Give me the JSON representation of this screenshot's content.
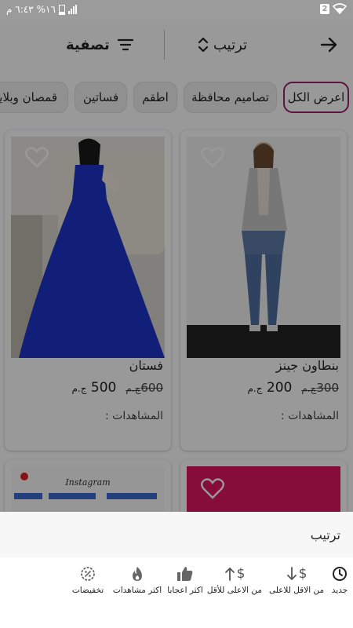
{
  "status_bar": {
    "time": "٦:٤٣ م",
    "battery": "%١٦",
    "sim": "2"
  },
  "toolbar": {
    "sort_label": "ترتيب",
    "filter_label": "تصفية"
  },
  "chips": [
    {
      "label": "اعرض الكل",
      "active": true
    },
    {
      "label": "تصاميم محافظة",
      "active": false
    },
    {
      "label": "اطقم",
      "active": false
    },
    {
      "label": "فساتين",
      "active": false
    },
    {
      "label": "قمصان وبلايز",
      "active": false
    }
  ],
  "products": [
    {
      "name": "بنطاون جينز",
      "old_price": "300",
      "new_price": "200",
      "currency": "ج.م",
      "views_label": "المشاهدات :"
    },
    {
      "name": "فستان",
      "old_price": "600",
      "new_price": "500",
      "currency": "ج.م",
      "views_label": "المشاهدات :"
    }
  ],
  "third_row": {
    "instagram_text": "Instagram"
  },
  "sort_sheet": {
    "title": "ترتيب",
    "options": [
      {
        "label": "جديد",
        "icon": "clock-icon"
      },
      {
        "label": "من الاقل للاعلى",
        "icon": "arrow-down-dollar-icon"
      },
      {
        "label": "من الاعلى للأقل",
        "icon": "arrow-up-dollar-icon"
      },
      {
        "label": "اكثر اعجابا",
        "icon": "thumbs-up-icon"
      },
      {
        "label": "اكثر مشاهدات",
        "icon": "fire-icon"
      },
      {
        "label": "تخفيضات",
        "icon": "discount-badge-icon"
      }
    ]
  },
  "colors": {
    "accent": "#9c1f6d",
    "dress_blue": "#1f35c9",
    "pink_card": "#e0165f"
  }
}
